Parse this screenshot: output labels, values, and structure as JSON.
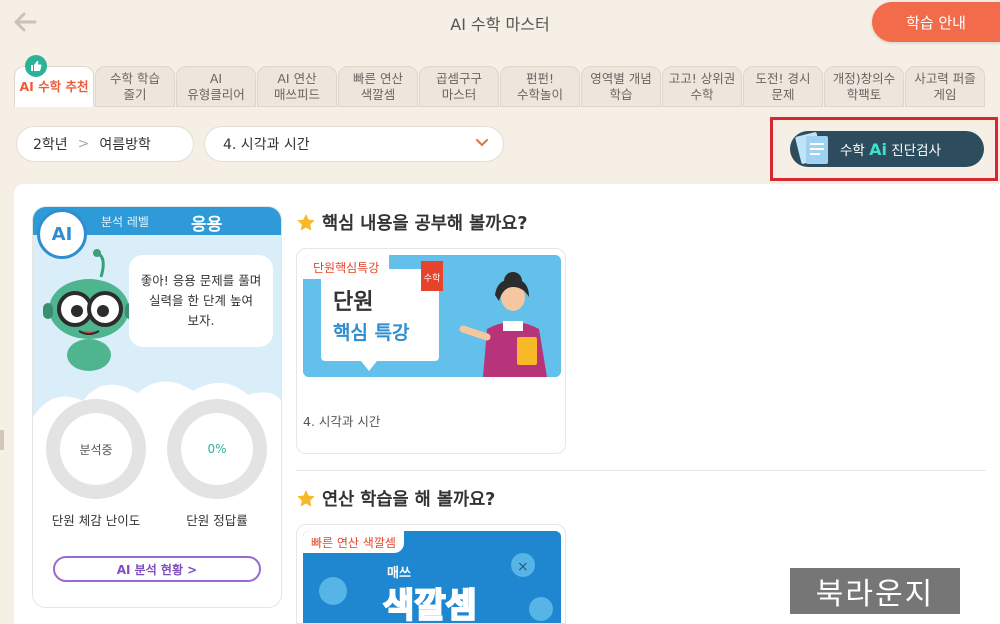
{
  "header": {
    "title": "AI 수학 마스터",
    "guide_button": "학습 안내"
  },
  "tabs": [
    {
      "label": "AI 수학 추천",
      "active": true
    },
    {
      "label": "수학 학습\n줄기"
    },
    {
      "label": "AI\n유형클리어"
    },
    {
      "label": "AI 연산\n매쓰피드"
    },
    {
      "label": "빠른 연산\n색깔셈"
    },
    {
      "label": "곱셈구구\n마스터"
    },
    {
      "label": "펀펀!\n수학놀이"
    },
    {
      "label": "영역별 개념\n학습"
    },
    {
      "label": "고고! 상위권\n수학"
    },
    {
      "label": "도전! 경시\n문제"
    },
    {
      "label": "개정)창의수\n학팩토"
    },
    {
      "label": "사고력 퍼즐\n게임"
    }
  ],
  "selectors": {
    "grade": "2학년",
    "term": "여름방학",
    "unit": "4. 시각과 시간"
  },
  "diagnostic": {
    "label": "수학 Ai 진단검사"
  },
  "ai_card": {
    "badge": "AI",
    "analysis_label": "분석 레벨",
    "level": "응용",
    "message": "좋아! 응용 문제를 풀며\n실력을 한 단계 높여\n보자.",
    "gauge1_value": "분석중",
    "gauge1_label": "단원 체감 난이도",
    "gauge2_value": "0%",
    "gauge2_label": "단원 정답률",
    "status_button": "AI 분석 현황 >"
  },
  "sections": [
    {
      "title": "핵심 내용을 공부해 볼까요?",
      "card_tag": "단원핵심특강",
      "card_title_line1": "단원",
      "card_title_line2": "핵심 특강",
      "card_badge": "수학",
      "card_caption": "4. 시각과 시간"
    },
    {
      "title": "연산 학습을 해 볼까요?",
      "card_tag": "빠른 연산 색깔셈",
      "card_logo_small": "매쓰",
      "card_logo": "색깔셈"
    }
  ],
  "watermark": "북라운지",
  "colors": {
    "accent": "#f26b4a",
    "ai_blue": "#2e9ad8",
    "diag_dark": "#2d4d5f",
    "highlight_red": "#d9272f"
  }
}
